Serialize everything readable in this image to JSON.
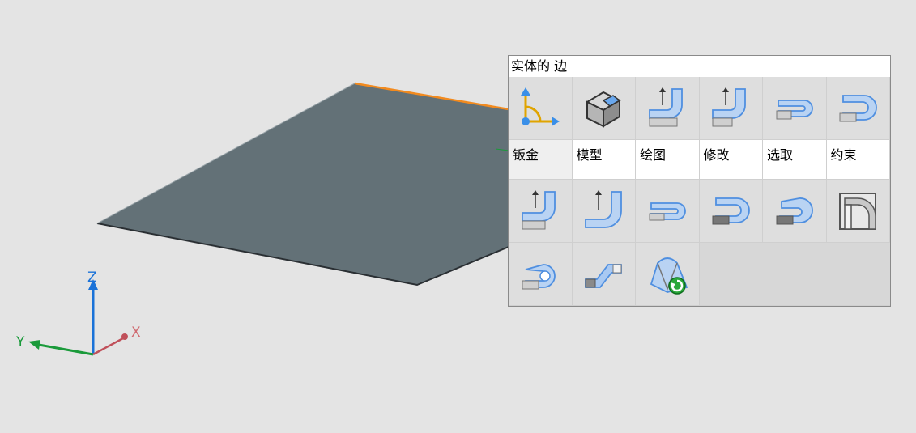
{
  "axes": {
    "x_label": "X",
    "y_label": "Y",
    "z_label": "Z"
  },
  "panel": {
    "title": "实体的 边",
    "tabs": [
      {
        "label": "钣金",
        "icon": "sheet-metal-axis-icon",
        "active": true
      },
      {
        "label": "模型",
        "icon": "solid-box-icon"
      },
      {
        "label": "绘图",
        "icon": "flange-draw-icon"
      },
      {
        "label": "修改",
        "icon": "flange-modify-icon"
      },
      {
        "label": "选取",
        "icon": "hem-select-icon"
      },
      {
        "label": "约束",
        "icon": "hem-constraint-icon"
      }
    ],
    "tools_row2": [
      "flange-icon",
      "contour-flange-icon",
      "hem-open-icon",
      "hem-closed-icon",
      "hem-teardrop-icon",
      "bend-corner-icon"
    ],
    "tools_row3": [
      "hem-rolled-icon",
      "jog-icon",
      "unfold-icon"
    ]
  },
  "colors": {
    "plate": "#637177",
    "edge": "#f28a1e",
    "axis_x": "#c0505a",
    "axis_y": "#1a9a3a",
    "axis_z": "#1a72d8",
    "icon_blue": "#4f8fe0"
  }
}
